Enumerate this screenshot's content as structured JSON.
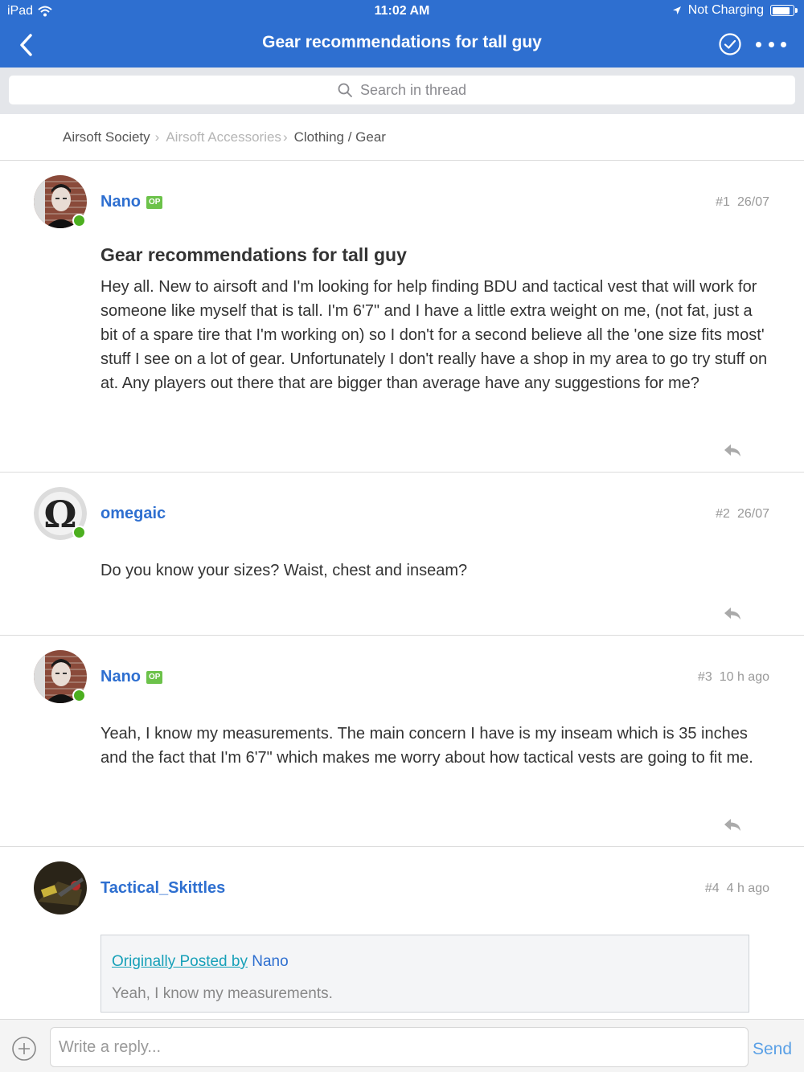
{
  "status_bar": {
    "device": "iPad",
    "time": "11:02 AM",
    "charging": "Not Charging"
  },
  "nav": {
    "title": "Gear recommendations for tall guy",
    "back_icon": "chevron-left-icon",
    "check_icon": "check-circle-icon",
    "more_icon": "more-dots-icon"
  },
  "search": {
    "placeholder": "Search in thread"
  },
  "breadcrumb": {
    "items": [
      "Airsoft Society",
      "Airsoft Accessories",
      "Clothing / Gear"
    ]
  },
  "posts": [
    {
      "author": "Nano",
      "badge": "OP",
      "number": "#1",
      "date": "26/07",
      "title": "Gear recommendations for tall guy",
      "body": "Hey all.  New to airsoft and I'm looking for help finding BDU and tactical vest that will work for someone like myself that is tall. I'm 6'7\" and I have a little extra weight on me, (not fat, just a bit of a spare tire that I'm working on) so I don't for a second believe all the 'one size fits most' stuff I see on a lot of gear.  Unfortunately I don't really have a shop in my area to go try stuff on at.  Any players out there that are bigger than average have any suggestions for me?",
      "online": true
    },
    {
      "author": "omegaic",
      "number": "#2",
      "date": "26/07",
      "body": "Do you know your sizes? Waist, chest and inseam?",
      "online": true
    },
    {
      "author": "Nano",
      "badge": "OP",
      "number": "#3",
      "date": "10 h ago",
      "body": "Yeah,  I know my measurements.  The main concern I have is my inseam which is 35 inches and the fact that I'm 6'7\" which makes me worry about how tactical vests are going to fit me.",
      "online": true
    },
    {
      "author": "Tactical_Skittles",
      "number": "#4",
      "date": "4 h ago",
      "quote": {
        "prefix": "Originally Posted by",
        "author": "Nano",
        "text": "Yeah,  I know my measurements."
      },
      "online": false
    }
  ],
  "composer": {
    "placeholder": "Write a reply...",
    "send_label": "Send"
  },
  "colors": {
    "brand_blue": "#2e6fd0",
    "online_green": "#4caf1f",
    "op_badge_green": "#6cc24a"
  }
}
